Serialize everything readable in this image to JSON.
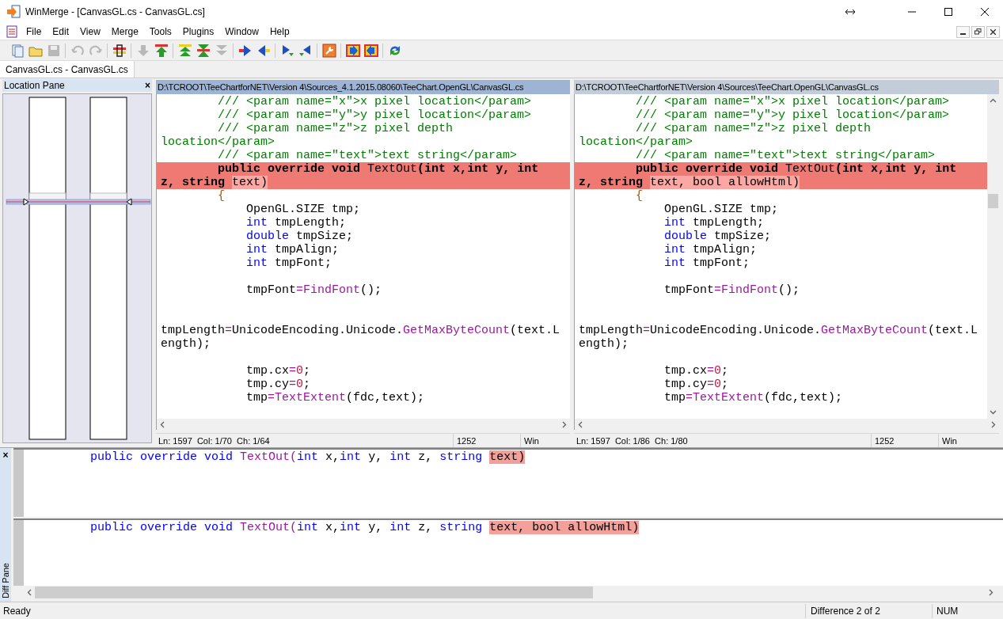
{
  "window": {
    "title": "WinMerge - [CanvasGL.cs - CanvasGL.cs]"
  },
  "menu": [
    "File",
    "Edit",
    "View",
    "Merge",
    "Tools",
    "Plugins",
    "Window",
    "Help"
  ],
  "toolbar": [
    [
      {
        "disabled": false
      },
      {
        "disabled": false
      },
      {
        "disabled": true
      }
    ],
    [
      {
        "disabled": true
      },
      {
        "disabled": true
      }
    ],
    [
      {
        "disabled": false
      }
    ],
    [
      {
        "disabled": true
      },
      {
        "disabled": false
      }
    ],
    [
      {
        "disabled": false
      },
      {
        "disabled": false
      },
      {
        "disabled": true
      }
    ],
    [
      {
        "disabled": false
      },
      {
        "disabled": false
      }
    ],
    [
      {
        "disabled": false
      },
      {
        "disabled": false
      }
    ],
    [
      {
        "disabled": false
      }
    ],
    [
      {
        "disabled": false
      },
      {
        "disabled": false
      }
    ],
    [
      {
        "disabled": false
      }
    ]
  ],
  "tabs": [
    {
      "label": "CanvasGL.cs - CanvasGL.cs",
      "selected": true
    }
  ],
  "location_pane": {
    "title": "Location Pane",
    "close": "×"
  },
  "panes": [
    {
      "path": "D:\\TCROOT\\TeeChartforNET\\Version 4\\Sources_4.1.2015.08060\\TeeChart.OpenGL\\CanvasGL.cs",
      "active": true,
      "lines": [
        {
          "diff": false,
          "tokens": [
            {
              "kind": "comment",
              "text": "        /// <param name=\"x\">x pixel location</param>"
            }
          ]
        },
        {
          "diff": false,
          "tokens": [
            {
              "kind": "comment",
              "text": "        /// <param name=\"y\">y pixel location</param>"
            }
          ]
        },
        {
          "diff": false,
          "tokens": [
            {
              "kind": "comment",
              "text": "        /// <param name=\"z\">z pixel depth"
            }
          ]
        },
        {
          "diff": false,
          "tokens": [
            {
              "kind": "comment",
              "text": "location</param>"
            }
          ]
        },
        {
          "diff": false,
          "tokens": [
            {
              "kind": "comment",
              "text": "        /// <param name=\"text\">text string</param>"
            }
          ]
        },
        {
          "diff": true,
          "tokens": [
            {
              "kind": "kw",
              "text": "        public"
            },
            {
              "kind": "kw",
              "text": " override"
            },
            {
              "kind": "kw",
              "text": " void"
            },
            {
              "kind": "fn",
              "text": " TextOut"
            },
            {
              "kind": "plain",
              "text": "("
            },
            {
              "kind": "kw",
              "text": "int"
            },
            {
              "kind": "plain",
              "text": " x,"
            },
            {
              "kind": "kw",
              "text": "int"
            },
            {
              "kind": "plain",
              "text": " y, "
            },
            {
              "kind": "kw",
              "text": "int"
            }
          ]
        },
        {
          "diff": true,
          "tokens": [
            {
              "kind": "plain",
              "text": "z, "
            },
            {
              "kind": "kw",
              "text": "string "
            },
            {
              "kind": "changed",
              "text": "text)"
            }
          ]
        },
        {
          "diff": false,
          "tokens": [
            {
              "kind": "brace",
              "text": "        {"
            }
          ]
        },
        {
          "diff": false,
          "tokens": [
            {
              "kind": "plain",
              "text": "            OpenGL.SIZE tmp;"
            }
          ]
        },
        {
          "diff": false,
          "tokens": [
            {
              "kind": "kw",
              "text": "            int"
            },
            {
              "kind": "plain",
              "text": " tmpLength;"
            }
          ]
        },
        {
          "diff": false,
          "tokens": [
            {
              "kind": "kw",
              "text": "            double"
            },
            {
              "kind": "plain",
              "text": " tmpSize;"
            }
          ]
        },
        {
          "diff": false,
          "tokens": [
            {
              "kind": "kw",
              "text": "            int"
            },
            {
              "kind": "plain",
              "text": " tmpAlign;"
            }
          ]
        },
        {
          "diff": false,
          "tokens": [
            {
              "kind": "kw",
              "text": "            int"
            },
            {
              "kind": "plain",
              "text": " tmpFont;"
            }
          ]
        },
        {
          "kind": "blank"
        },
        {
          "diff": false,
          "tokens": [
            {
              "kind": "plain",
              "text": "            tmpFont"
            },
            {
              "kind": "op",
              "text": "="
            },
            {
              "kind": "fn",
              "text": "FindFont"
            },
            {
              "kind": "plain",
              "text": "();"
            }
          ]
        },
        {
          "kind": "blank"
        },
        {
          "kind": "blank"
        },
        {
          "diff": false,
          "tokens": [
            {
              "kind": "plain",
              "text": "tmpLength"
            },
            {
              "kind": "op",
              "text": "="
            },
            {
              "kind": "plain",
              "text": "UnicodeEncoding.Unicode."
            },
            {
              "kind": "fn",
              "text": "GetMaxByteCount"
            },
            {
              "kind": "plain",
              "text": "(text.L"
            }
          ]
        },
        {
          "diff": false,
          "tokens": [
            {
              "kind": "plain",
              "text": "ength);"
            }
          ]
        },
        {
          "kind": "blank"
        },
        {
          "diff": false,
          "tokens": [
            {
              "kind": "plain",
              "text": "            tmp.cx"
            },
            {
              "kind": "op",
              "text": "="
            },
            {
              "kind": "num",
              "text": "0"
            },
            {
              "kind": "plain",
              "text": ";"
            }
          ]
        },
        {
          "diff": false,
          "tokens": [
            {
              "kind": "plain",
              "text": "            tmp.cy"
            },
            {
              "kind": "op",
              "text": "="
            },
            {
              "kind": "num",
              "text": "0"
            },
            {
              "kind": "plain",
              "text": ";"
            }
          ]
        },
        {
          "diff": false,
          "tokens": [
            {
              "kind": "plain",
              "text": "            tmp"
            },
            {
              "kind": "op",
              "text": "="
            },
            {
              "kind": "fn",
              "text": "TextExtent"
            },
            {
              "kind": "plain",
              "text": "(fdc,text);"
            }
          ]
        }
      ],
      "status": {
        "position": "Ln: 1597  Col: 1/70  Ch: 1/64",
        "codepage": "1252",
        "eol": "Win"
      }
    },
    {
      "path": "D:\\TCROOT\\TeeChartforNET\\Version 4\\Sources\\TeeChart.OpenGL\\CanvasGL.cs",
      "active": false,
      "lines": [
        {
          "diff": false,
          "tokens": [
            {
              "kind": "comment",
              "text": "        /// <param name=\"x\">x pixel location</param>"
            }
          ]
        },
        {
          "diff": false,
          "tokens": [
            {
              "kind": "comment",
              "text": "        /// <param name=\"y\">y pixel location</param>"
            }
          ]
        },
        {
          "diff": false,
          "tokens": [
            {
              "kind": "comment",
              "text": "        /// <param name=\"z\">z pixel depth"
            }
          ]
        },
        {
          "diff": false,
          "tokens": [
            {
              "kind": "comment",
              "text": "location</param>"
            }
          ]
        },
        {
          "diff": false,
          "tokens": [
            {
              "kind": "comment",
              "text": "        /// <param name=\"text\">text string</param>"
            }
          ]
        },
        {
          "diff": true,
          "tokens": [
            {
              "kind": "kw",
              "text": "        public"
            },
            {
              "kind": "kw",
              "text": " override"
            },
            {
              "kind": "kw",
              "text": " void"
            },
            {
              "kind": "fn",
              "text": " TextOut"
            },
            {
              "kind": "plain",
              "text": "("
            },
            {
              "kind": "kw",
              "text": "int"
            },
            {
              "kind": "plain",
              "text": " x,"
            },
            {
              "kind": "kw",
              "text": "int"
            },
            {
              "kind": "plain",
              "text": " y, "
            },
            {
              "kind": "kw",
              "text": "int"
            }
          ]
        },
        {
          "diff": true,
          "tokens": [
            {
              "kind": "plain",
              "text": "z, "
            },
            {
              "kind": "kw",
              "text": "string "
            },
            {
              "kind": "changed",
              "text": "text, bool allowHtml)"
            }
          ]
        },
        {
          "diff": false,
          "tokens": [
            {
              "kind": "brace",
              "text": "        {"
            }
          ]
        },
        {
          "diff": false,
          "tokens": [
            {
              "kind": "plain",
              "text": "            OpenGL.SIZE tmp;"
            }
          ]
        },
        {
          "diff": false,
          "tokens": [
            {
              "kind": "kw",
              "text": "            int"
            },
            {
              "kind": "plain",
              "text": " tmpLength;"
            }
          ]
        },
        {
          "diff": false,
          "tokens": [
            {
              "kind": "kw",
              "text": "            double"
            },
            {
              "kind": "plain",
              "text": " tmpSize;"
            }
          ]
        },
        {
          "diff": false,
          "tokens": [
            {
              "kind": "kw",
              "text": "            int"
            },
            {
              "kind": "plain",
              "text": " tmpAlign;"
            }
          ]
        },
        {
          "diff": false,
          "tokens": [
            {
              "kind": "kw",
              "text": "            int"
            },
            {
              "kind": "plain",
              "text": " tmpFont;"
            }
          ]
        },
        {
          "kind": "blank"
        },
        {
          "diff": false,
          "tokens": [
            {
              "kind": "plain",
              "text": "            tmpFont"
            },
            {
              "kind": "op",
              "text": "="
            },
            {
              "kind": "fn",
              "text": "FindFont"
            },
            {
              "kind": "plain",
              "text": "();"
            }
          ]
        },
        {
          "kind": "blank"
        },
        {
          "kind": "blank"
        },
        {
          "diff": false,
          "tokens": [
            {
              "kind": "plain",
              "text": "tmpLength"
            },
            {
              "kind": "op",
              "text": "="
            },
            {
              "kind": "plain",
              "text": "UnicodeEncoding.Unicode."
            },
            {
              "kind": "fn",
              "text": "GetMaxByteCount"
            },
            {
              "kind": "plain",
              "text": "(text.L"
            }
          ]
        },
        {
          "diff": false,
          "tokens": [
            {
              "kind": "plain",
              "text": "ength);"
            }
          ]
        },
        {
          "kind": "blank"
        },
        {
          "diff": false,
          "tokens": [
            {
              "kind": "plain",
              "text": "            tmp.cx"
            },
            {
              "kind": "op",
              "text": "="
            },
            {
              "kind": "num",
              "text": "0"
            },
            {
              "kind": "plain",
              "text": ";"
            }
          ]
        },
        {
          "diff": false,
          "tokens": [
            {
              "kind": "plain",
              "text": "            tmp.cy"
            },
            {
              "kind": "op",
              "text": "="
            },
            {
              "kind": "num",
              "text": "0"
            },
            {
              "kind": "plain",
              "text": ";"
            }
          ]
        },
        {
          "diff": false,
          "tokens": [
            {
              "kind": "plain",
              "text": "            tmp"
            },
            {
              "kind": "op",
              "text": "="
            },
            {
              "kind": "fn",
              "text": "TextExtent"
            },
            {
              "kind": "plain",
              "text": "(fdc,text);"
            }
          ]
        }
      ],
      "status": {
        "position": "Ln: 1597  Col: 1/86  Ch: 1/80",
        "codepage": "1252",
        "eol": "Win"
      }
    }
  ],
  "diff_pane": {
    "title": "Diff Pane",
    "close": "×",
    "rows": [
      {
        "tokens": [
          {
            "kind": "kw",
            "text": "        public"
          },
          {
            "kind": "kw",
            "text": " override"
          },
          {
            "kind": "kw",
            "text": " void"
          },
          {
            "kind": "fn",
            "text": " TextOut("
          },
          {
            "kind": "kw",
            "text": "int"
          },
          {
            "kind": "plain",
            "text": " x,"
          },
          {
            "kind": "kw",
            "text": "int"
          },
          {
            "kind": "plain",
            "text": " y, "
          },
          {
            "kind": "kw",
            "text": "int"
          },
          {
            "kind": "plain",
            "text": " z, "
          },
          {
            "kind": "kw",
            "text": "string "
          },
          {
            "kind": "changed",
            "text": "text)"
          }
        ]
      },
      {
        "tokens": [
          {
            "kind": "kw",
            "text": "        public"
          },
          {
            "kind": "kw",
            "text": " override"
          },
          {
            "kind": "kw",
            "text": " void"
          },
          {
            "kind": "fn",
            "text": " TextOut("
          },
          {
            "kind": "kw",
            "text": "int"
          },
          {
            "kind": "plain",
            "text": " x,"
          },
          {
            "kind": "kw",
            "text": "int"
          },
          {
            "kind": "plain",
            "text": " y, "
          },
          {
            "kind": "kw",
            "text": "int"
          },
          {
            "kind": "plain",
            "text": " z, "
          },
          {
            "kind": "kw",
            "text": "string "
          },
          {
            "kind": "changed",
            "text": "text, bool allowHtml)"
          }
        ]
      }
    ]
  },
  "status_bar": {
    "message": "Ready",
    "difference": "Difference 2 of 2",
    "num": "NUM"
  }
}
